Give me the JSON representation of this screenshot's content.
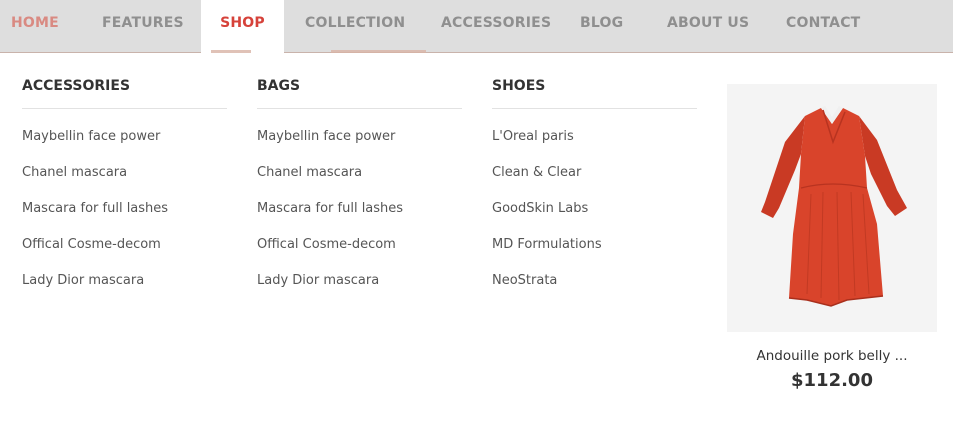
{
  "nav": {
    "items": [
      {
        "label": "HOME",
        "state": "home"
      },
      {
        "label": "FEATURES",
        "state": ""
      },
      {
        "label": "SHOP",
        "state": "active"
      },
      {
        "label": "COLLECTION",
        "state": ""
      },
      {
        "label": "ACCESSORIES",
        "state": ""
      },
      {
        "label": "BLOG",
        "state": ""
      },
      {
        "label": "ABOUT US",
        "state": ""
      },
      {
        "label": "CONTACT",
        "state": ""
      }
    ]
  },
  "mega_menu": {
    "columns": [
      {
        "title": "ACCESSORIES",
        "links": [
          "Maybellin face power",
          "Chanel mascara",
          "Mascara for full lashes",
          "Offical Cosme-decom",
          "Lady Dior mascara"
        ]
      },
      {
        "title": "BAGS",
        "links": [
          "Maybellin face power",
          "Chanel mascara",
          "Mascara for full lashes",
          "Offical Cosme-decom",
          "Lady Dior mascara"
        ]
      },
      {
        "title": "SHOES",
        "links": [
          "L'Oreal paris",
          "Clean & Clear",
          "GoodSkin Labs",
          "MD Formulations",
          "NeoStrata"
        ]
      }
    ],
    "featured_product": {
      "name": "Andouille pork belly ...",
      "price": "$112.00",
      "image_icon": "red-dress-image"
    }
  },
  "colors": {
    "accent": "#d6423a",
    "home": "#d98a82",
    "nav_bg": "#dedede",
    "dress": "#d9442b"
  }
}
